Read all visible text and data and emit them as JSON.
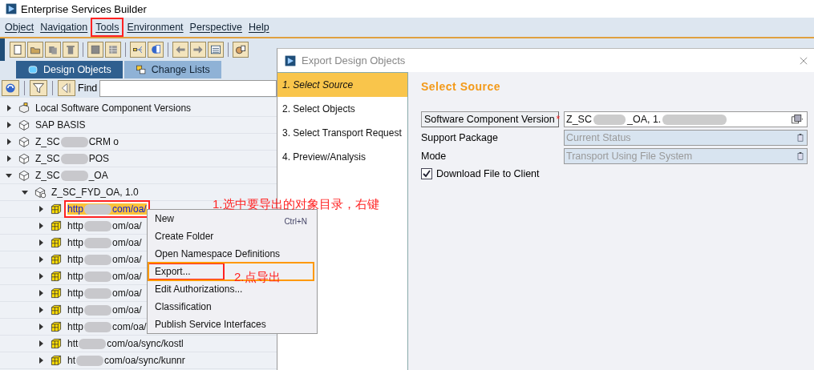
{
  "window": {
    "title": "Enterprise Services Builder"
  },
  "menu": [
    {
      "label": "Object",
      "marked": false
    },
    {
      "label": "Navigation",
      "marked": false
    },
    {
      "label": "Tools",
      "marked": true
    },
    {
      "label": "Environment",
      "marked": false
    },
    {
      "label": "Perspective",
      "marked": false
    },
    {
      "label": "Help",
      "marked": false
    }
  ],
  "tabs": [
    {
      "label": "Design Objects",
      "selected": true
    },
    {
      "label": "Change Lists",
      "selected": false
    }
  ],
  "find": {
    "label": "Find"
  },
  "tree": [
    {
      "kind": "local",
      "label": "Local Software Component Versions",
      "expanded": false
    },
    {
      "kind": "swc",
      "label": "SAP BASIS",
      "expanded": false
    },
    {
      "kind": "swc",
      "label": "Z_SC",
      "tail": "CRM o",
      "expanded": false
    },
    {
      "kind": "swc",
      "label": "Z_SC",
      "tail": "POS",
      "expanded": false
    },
    {
      "kind": "swc",
      "label": "Z_SC",
      "tail": "_OA",
      "expanded": true,
      "children": [
        {
          "kind": "version",
          "label": "Z_SC_FYD_OA, 1.0",
          "expanded": true,
          "children": [
            {
              "kind": "namespace",
              "label": "http",
              "tail": "com/oa/",
              "expanded": false,
              "selected": true
            },
            {
              "kind": "namespace",
              "label": "http",
              "tail": "om/oa/",
              "expanded": false,
              "selected": false
            },
            {
              "kind": "namespace",
              "label": "http",
              "tail": "om/oa/",
              "expanded": false,
              "selected": false
            },
            {
              "kind": "namespace",
              "label": "http",
              "tail": "om/oa/",
              "expanded": false,
              "selected": false
            },
            {
              "kind": "namespace",
              "label": "http",
              "tail": "om/oa/",
              "expanded": false,
              "selected": false
            },
            {
              "kind": "namespace",
              "label": "http",
              "tail": "om/oa/",
              "expanded": false,
              "selected": false
            },
            {
              "kind": "namespace",
              "label": "http",
              "tail": "om/oa/",
              "expanded": false,
              "selected": false
            },
            {
              "kind": "namespace",
              "label": "http",
              "tail": "com/oa/",
              "expanded": false,
              "selected": false
            },
            {
              "kind": "namespace",
              "label": "htt",
              "tail": "com/oa/sync/kostl",
              "expanded": false,
              "selected": false
            },
            {
              "kind": "namespace",
              "label": "ht",
              "tail": "com/oa/sync/kunnr",
              "expanded": false,
              "selected": false
            }
          ]
        }
      ]
    }
  ],
  "context_menu": [
    {
      "label": "New",
      "shortcut": "Ctrl+N",
      "marked": false
    },
    {
      "label": "Create Folder",
      "marked": false
    },
    {
      "label": "Open Namespace Definitions",
      "marked": false
    },
    {
      "label": "Export...",
      "marked": true
    },
    {
      "label": "Edit Authorizations...",
      "marked": false
    },
    {
      "label": "Classification",
      "marked": false
    },
    {
      "label": "Publish Service Interfaces",
      "marked": false
    }
  ],
  "annotations": [
    {
      "text": "1.选中要导出的对象目录，右键"
    },
    {
      "text": "2.点导出"
    }
  ],
  "dialog": {
    "title": "Export Design Objects",
    "steps": [
      {
        "label": "1. Select Source",
        "selected": true
      },
      {
        "label": "2. Select Objects",
        "selected": false
      },
      {
        "label": "3. Select Transport Request",
        "selected": false
      },
      {
        "label": "4. Preview/Analysis",
        "selected": false
      }
    ],
    "heading": "Select Source",
    "component": {
      "button": "Software Component Version",
      "required": "*",
      "value": "Z_SC",
      "value_tail": "_OA, 1."
    },
    "fields": [
      {
        "label": "Support Package",
        "value": "Current Status",
        "disabled": true
      },
      {
        "label": "Mode",
        "value": "Transport Using File System",
        "disabled": true
      }
    ],
    "checkbox": {
      "label": "Download File to Client",
      "checked": true
    }
  }
}
